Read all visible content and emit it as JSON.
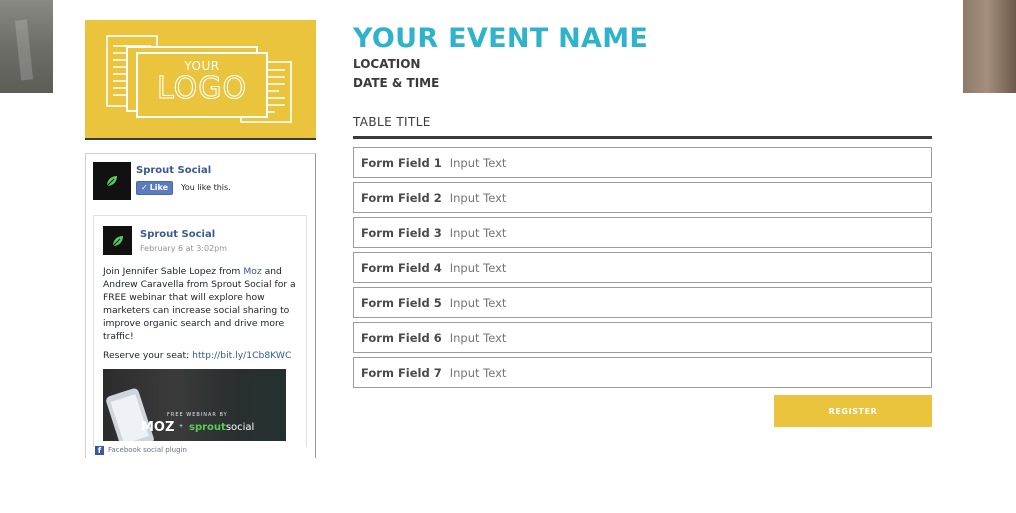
{
  "colors": {
    "accent_yellow": "#e9c43c",
    "title_teal": "#2fb3cc",
    "text_dark": "#3a3a3a",
    "facebook_blue": "#3b5998"
  },
  "logo": {
    "line1": "YOUR",
    "line2": "LOGO"
  },
  "facebook_widget": {
    "page_name": "Sprout Social",
    "like_label": "Like",
    "you_like_text": "You like this.",
    "post": {
      "author": "Sprout Social",
      "date": "February 6 at 3:02pm",
      "body_part1": "Join Jennifer Sable Lopez from ",
      "body_link": "Moz",
      "body_part2": " and Andrew Caravella from Sprout Social for a FREE webinar that will explore how marketers can increase social sharing to improve organic search and drive more traffic!",
      "reserve_text": "Reserve your seat: ",
      "reserve_link": "http://bit.ly/1Cb8KWC",
      "image": {
        "tag": "FREE WEBINAR BY",
        "brand_left": "MOZ",
        "plus": "+",
        "brand_right_part1": "sprout",
        "brand_right_part2": "social"
      }
    },
    "plugin_label": "Facebook social plugin",
    "icons": {
      "page_avatar": "sprout-leaf-icon",
      "like": "thumbs-up-icon",
      "facebook": "facebook-f-icon"
    }
  },
  "event": {
    "title": "YOUR EVENT NAME",
    "location": "LOCATION",
    "datetime": "DATE & TIME"
  },
  "form": {
    "table_title": "TABLE TITLE",
    "fields": [
      {
        "label": "Form Field 1",
        "placeholder": "Input Text"
      },
      {
        "label": "Form Field 2",
        "placeholder": "Input Text"
      },
      {
        "label": "Form Field 3",
        "placeholder": "Input Text"
      },
      {
        "label": "Form Field 4",
        "placeholder": "Input Text"
      },
      {
        "label": "Form Field 5",
        "placeholder": "Input Text"
      },
      {
        "label": "Form Field 6",
        "placeholder": "Input Text"
      },
      {
        "label": "Form Field 7",
        "placeholder": "Input Text"
      }
    ],
    "register_label": "REGISTER"
  }
}
